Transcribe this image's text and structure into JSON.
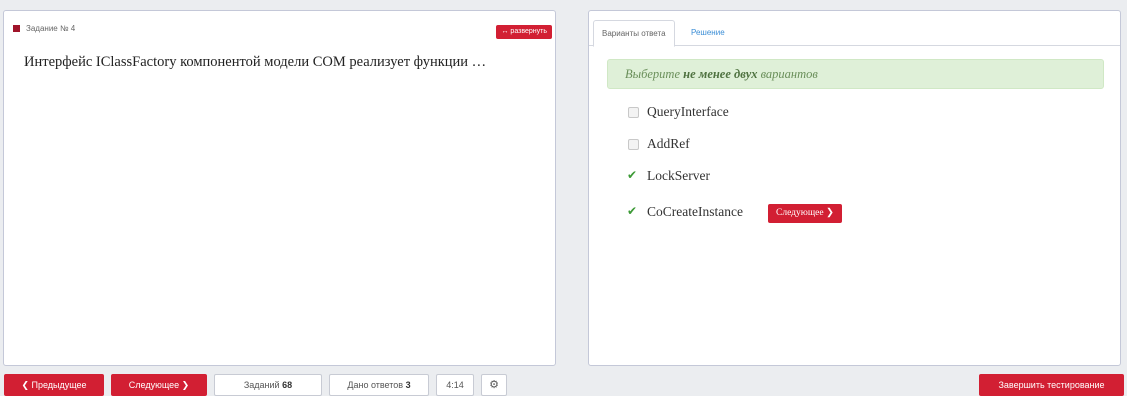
{
  "task_panel": {
    "task_label": "Задание № 4",
    "expand_label": "↔ развернуть",
    "question": "Интерфейс IClassFactory компонентой модели COM реализует функции …"
  },
  "answer_panel": {
    "tabs": [
      "Варианты ответа",
      "Решение"
    ],
    "hint_prefix": "Выберите ",
    "hint_bold": "не менее двух",
    "hint_suffix": " вариантов",
    "options": [
      {
        "label": "QueryInterface",
        "checked": false
      },
      {
        "label": "AddRef",
        "checked": false
      },
      {
        "label": "LockServer",
        "checked": true
      },
      {
        "label": "CoCreateInstance",
        "checked": true
      }
    ],
    "next_inline_label": "Следующее ❯"
  },
  "footer": {
    "prev_label": "❮ Предыдущее",
    "next_label": "Следующее ❯",
    "tasks_label": "Заданий",
    "tasks_count": "68",
    "answers_label": "Дано ответов",
    "answers_count": "3",
    "timer": "4:14",
    "settings_icon": "gear-icon",
    "finish_label": "Завершить тестирование"
  }
}
